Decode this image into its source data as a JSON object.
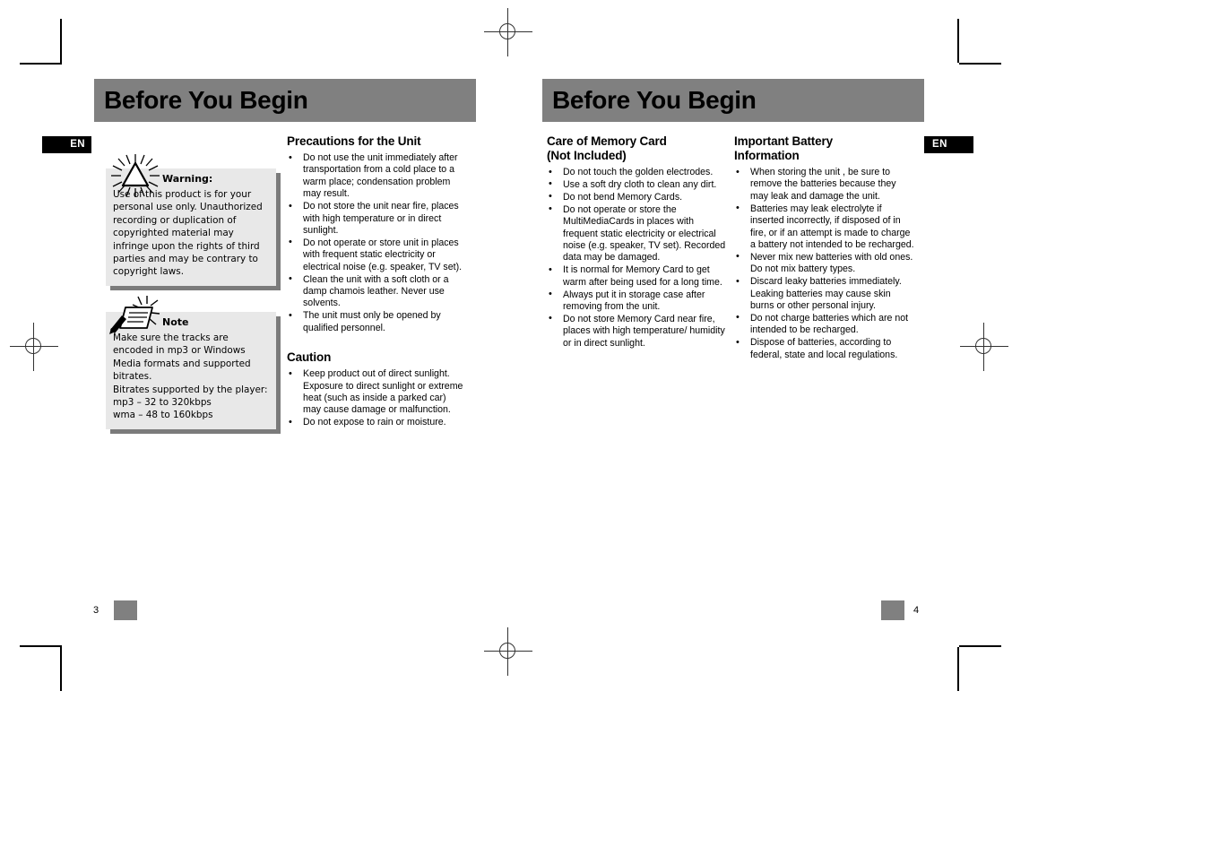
{
  "document": {
    "language_badge": "EN",
    "spread_title": "Before You Begin"
  },
  "left_page": {
    "header_title": "Before You Begin",
    "badge": "EN",
    "folio": "3",
    "warning": {
      "icon": "warning-triangle-burst-icon",
      "title": "Warning:",
      "body": "Use of this product is for your personal use only.  Unauthorized recording or duplication of copyrighted material may infringe upon the rights of third parties and may be contrary to copyright laws."
    },
    "note": {
      "icon": "note-pen-paper-icon",
      "title": "Note",
      "body": "Make sure the tracks are encoded in mp3 or Windows Media formats and supported bitrates.\nBitrates supported by the player:\nmp3  – 32 to 320kbps\nwma – 48 to 160kbps"
    },
    "precautions": {
      "heading": "Precautions for the Unit",
      "items": [
        "Do not use the unit immediately after transportation from a cold place to a warm place; condensation problem may result.",
        "Do not store the unit near fire, places with high temperature or in direct sunlight.",
        "Do not operate or store unit in places with frequent static electricity or electrical noise (e.g. speaker, TV set).",
        "Clean the unit with a soft cloth or a damp chamois leather. Never use solvents.",
        "The unit must only be opened by qualified personnel."
      ]
    },
    "caution": {
      "heading": "Caution",
      "items": [
        "Keep product out of direct sunlight. Exposure to direct sunlight or extreme heat (such as inside a parked car) may cause damage or malfunction.",
        "Do not expose to rain or moisture."
      ]
    }
  },
  "right_page": {
    "header_title": "Before You Begin",
    "badge": "EN",
    "folio": "4",
    "memory_card": {
      "heading_line1": "Care of  Memory Card",
      "heading_line2": "(Not Included)",
      "items": [
        "Do not touch the golden electrodes.",
        "Use a soft dry cloth to clean any dirt.",
        "Do not bend Memory Cards.",
        "Do not operate or store the MultiMediaCards in places with frequent static electricity or electrical noise (e.g. speaker, TV set). Recorded data may be damaged.",
        "It is normal for Memory Card to get warm after being used for a long time.",
        "Always put it in storage case after removing from the unit.",
        "Do not store Memory Card near fire, places with high temperature/ humidity or in direct sunlight."
      ]
    },
    "battery": {
      "heading_line1": "Important Battery",
      "heading_line2": "Information",
      "items": [
        "When storing the unit , be sure to remove the batteries because they may leak and damage the unit.",
        "Batteries may leak electrolyte if inserted incorrectly, if disposed of in fire, or if an attempt is made to charge a battery not intended to be recharged.",
        "Never mix new batteries with old ones. Do not mix battery types.",
        "Discard leaky batteries immediately. Leaking batteries may cause skin burns or other personal injury.",
        "Do not charge batteries which are not intended to be recharged.",
        "Dispose of batteries, according to federal, state and local regulations."
      ]
    }
  },
  "colors": {
    "header_gray": "#808080",
    "callout_fill": "#e8e8e8",
    "callout_shadow": "#7b7b7b",
    "badge_black": "#000000"
  }
}
